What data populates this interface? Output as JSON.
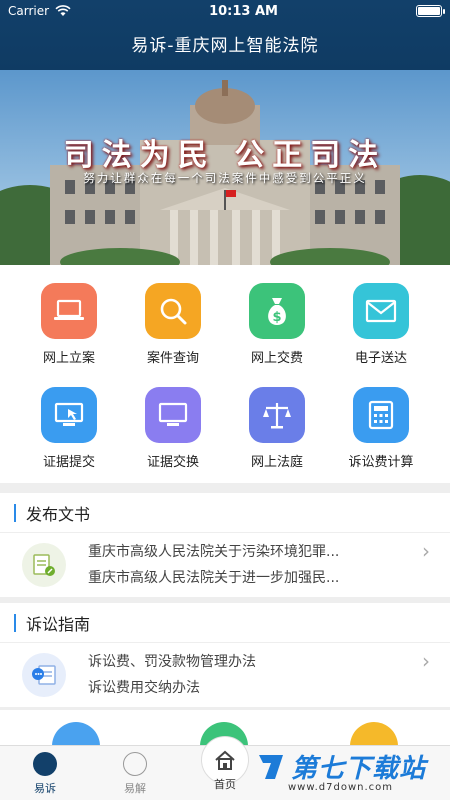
{
  "status_bar": {
    "carrier": "Carrier",
    "time": "10:13 AM"
  },
  "nav": {
    "title": "易诉-重庆网上智能法院"
  },
  "banner": {
    "slogan": "司法为民 公正司法",
    "subtitle": "努力让群众在每一个司法案件中感受到公平正义"
  },
  "grid": [
    {
      "label": "网上立案",
      "icon": "laptop-icon",
      "color": "#f47a5a"
    },
    {
      "label": "案件查询",
      "icon": "search-icon",
      "color": "#f5a623"
    },
    {
      "label": "网上交费",
      "icon": "money-bag-icon",
      "color": "#3cc37a"
    },
    {
      "label": "电子送达",
      "icon": "envelope-icon",
      "color": "#35c4d8"
    },
    {
      "label": "证据提交",
      "icon": "monitor-click-icon",
      "color": "#3a9cf0"
    },
    {
      "label": "证据交换",
      "icon": "monitor-icon",
      "color": "#8a7df0"
    },
    {
      "label": "网上法庭",
      "icon": "scales-icon",
      "color": "#6a7ee8"
    },
    {
      "label": "诉讼费计算",
      "icon": "calculator-icon",
      "color": "#3a9cf0"
    }
  ],
  "sections": {
    "publish": {
      "title": "发布文书",
      "icon": "document-edit-icon",
      "lines": [
        "重庆市高级人民法院关于污染环境犯罪...",
        "重庆市高级人民法院关于进一步加强民..."
      ]
    },
    "guide": {
      "title": "诉讼指南",
      "icon": "chat-document-icon",
      "lines": [
        "诉讼费、罚没款物管理办法",
        "诉讼费用交纳办法"
      ]
    }
  },
  "tabbar": {
    "tabs": [
      {
        "label": "易诉",
        "icon": "yisu-icon"
      },
      {
        "label": "易解",
        "icon": "yijie-icon"
      },
      {
        "label": "首页",
        "icon": "home-icon"
      }
    ],
    "active": "易诉"
  },
  "watermark": {
    "text": "第七下载站",
    "url": "www.d7down.com"
  }
}
